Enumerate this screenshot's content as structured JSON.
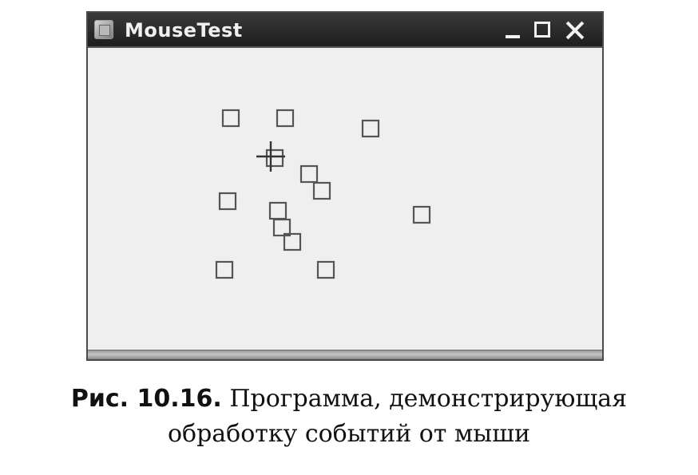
{
  "window": {
    "title": "MouseTest",
    "title_icon": "app-icon",
    "controls": {
      "minimize_icon": "minimize-icon",
      "maximize_icon": "maximize-icon",
      "close_icon": "close-icon"
    }
  },
  "canvas": {
    "square_color": "#555555",
    "cursor_icon": "crosshair-icon"
  },
  "caption": {
    "label": "Рис. 10.16.",
    "line1": "Программа, демонстрирующая",
    "line2": "обработку событий от мыши"
  }
}
